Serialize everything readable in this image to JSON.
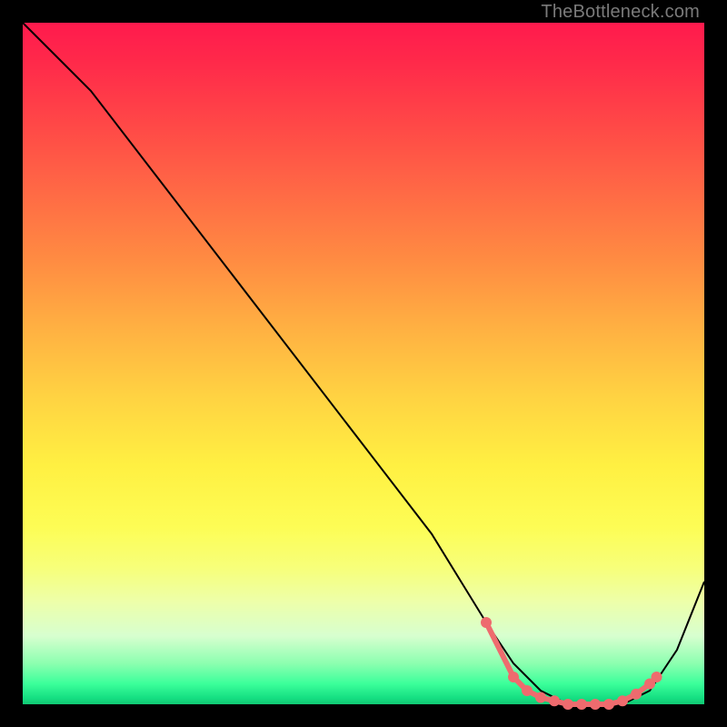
{
  "attribution": "TheBottleneck.com",
  "colors": {
    "dot": "#ee6b6e",
    "line": "#000000"
  },
  "chart_data": {
    "type": "line",
    "title": "",
    "xlabel": "",
    "ylabel": "",
    "xlim": [
      0,
      100
    ],
    "ylim": [
      0,
      100
    ],
    "grid": false,
    "series": [
      {
        "name": "bottleneck-curve",
        "x": [
          0,
          6,
          10,
          20,
          30,
          40,
          50,
          60,
          68,
          72,
          76,
          80,
          84,
          88,
          92,
          96,
          100
        ],
        "y": [
          100,
          94,
          90,
          77,
          64,
          51,
          38,
          25,
          12,
          6,
          2,
          0,
          0,
          0,
          2,
          8,
          18
        ]
      }
    ],
    "markers": {
      "name": "highlight-dots",
      "x": [
        68,
        72,
        74,
        76,
        78,
        80,
        82,
        84,
        86,
        88,
        90,
        92,
        93
      ],
      "y": [
        12,
        4,
        2,
        1,
        0.5,
        0,
        0,
        0,
        0,
        0.5,
        1.5,
        3,
        4
      ]
    }
  }
}
